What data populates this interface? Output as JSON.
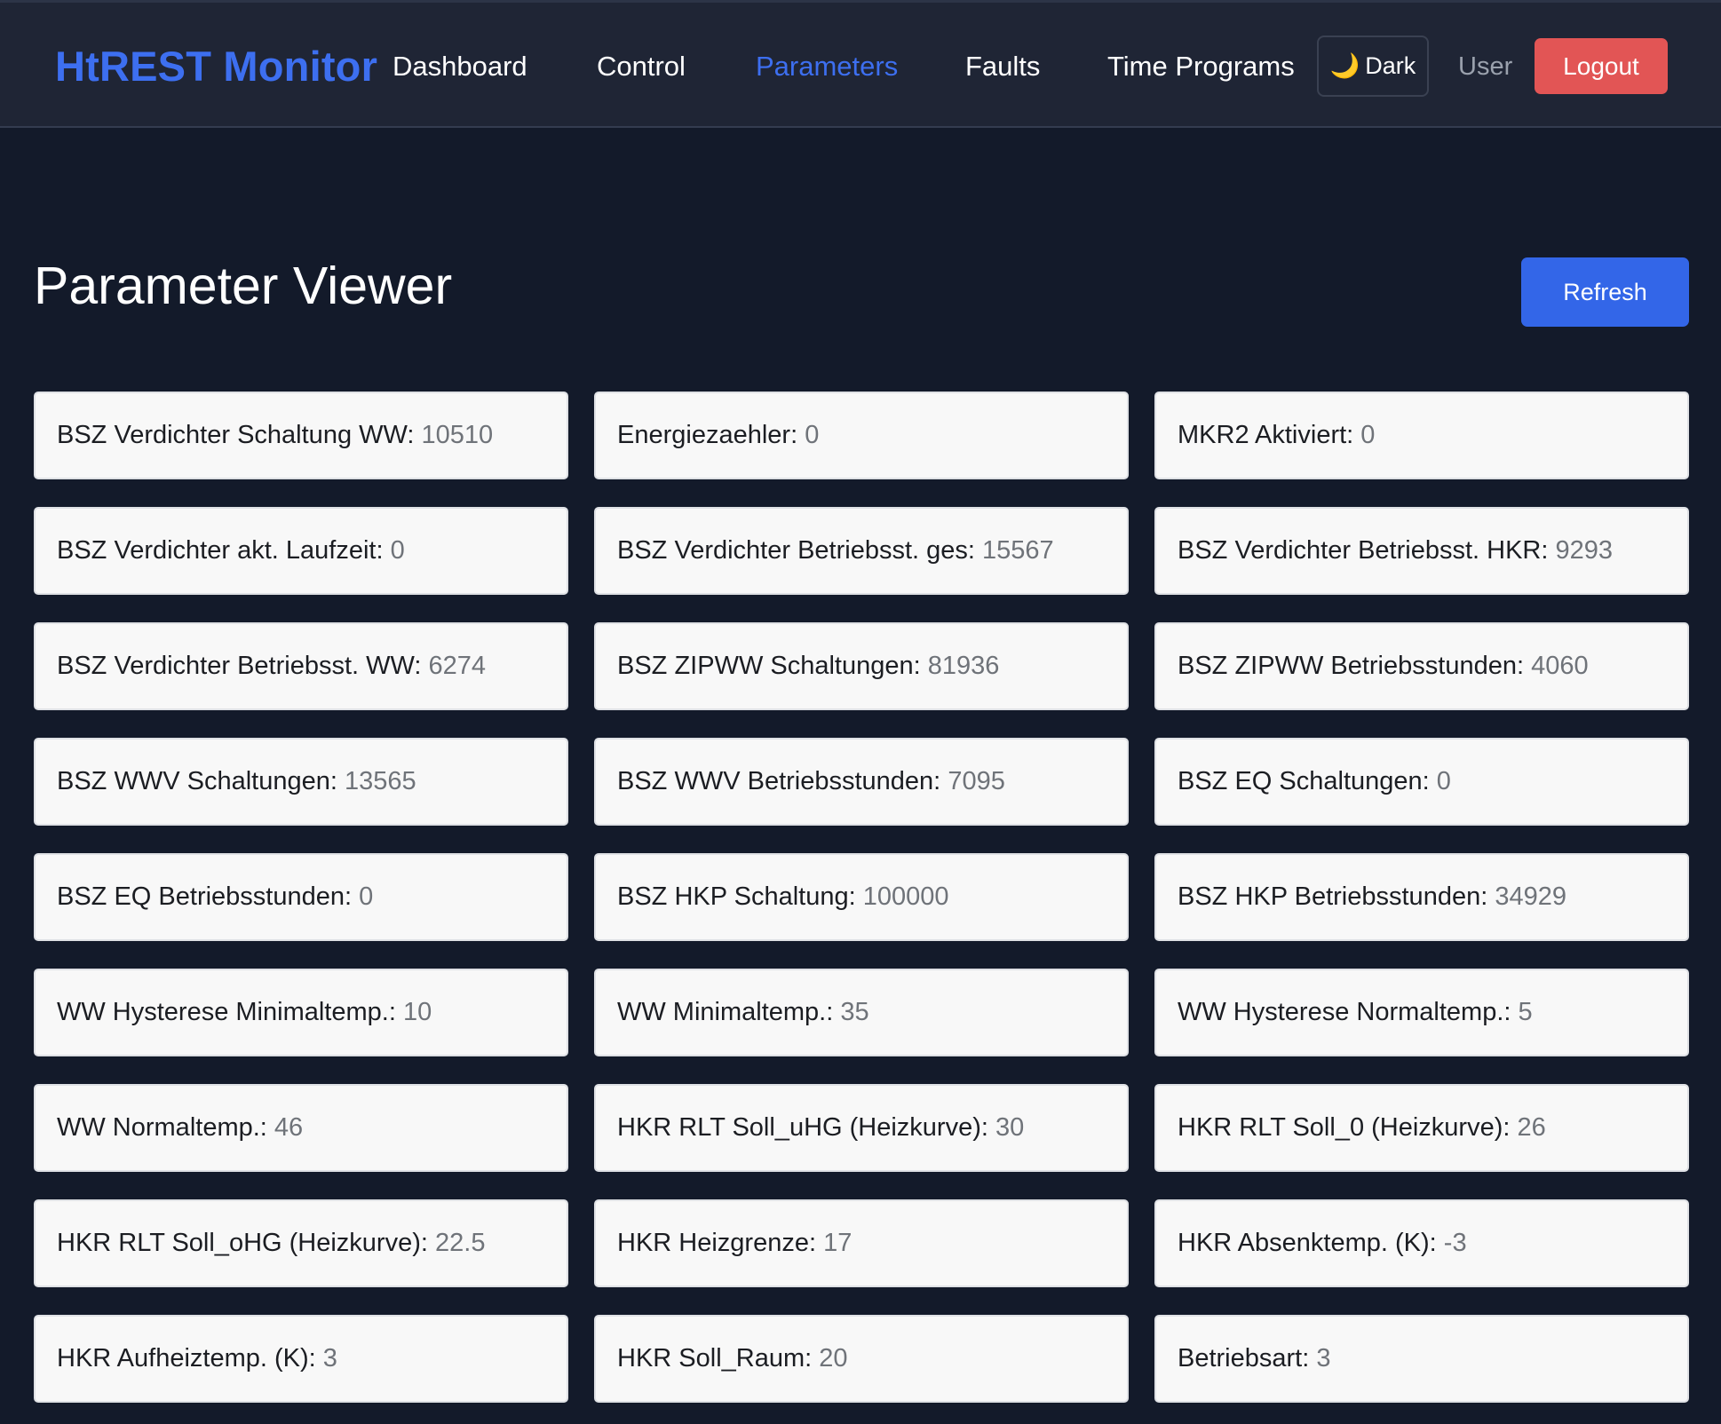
{
  "nav": {
    "brand": "HtREST Monitor",
    "links": [
      {
        "label": "Dashboard",
        "active": false
      },
      {
        "label": "Control",
        "active": false
      },
      {
        "label": "Parameters",
        "active": true
      },
      {
        "label": "Faults",
        "active": false
      },
      {
        "label": "Time Programs",
        "active": false
      }
    ],
    "theme_toggle": {
      "icon": "🌙",
      "icon_name": "moon-icon",
      "label": "Dark"
    },
    "user_label": "User",
    "logout_label": "Logout"
  },
  "page": {
    "title": "Parameter Viewer",
    "refresh_label": "Refresh"
  },
  "colors": {
    "background": "#131a2a",
    "navbar": "#1f2535",
    "accent": "#3d6ff0",
    "logout": "#e25555",
    "refresh": "#3366e8",
    "card": "#f8f8f8"
  },
  "parameters": [
    {
      "name": "BSZ Verdichter Schaltung WW:",
      "value": "10510"
    },
    {
      "name": "Energiezaehler:",
      "value": "0"
    },
    {
      "name": "MKR2 Aktiviert:",
      "value": "0"
    },
    {
      "name": "BSZ Verdichter akt. Laufzeit:",
      "value": "0"
    },
    {
      "name": "BSZ Verdichter Betriebsst. ges:",
      "value": "15567"
    },
    {
      "name": "BSZ Verdichter Betriebsst. HKR:",
      "value": "9293"
    },
    {
      "name": "BSZ Verdichter Betriebsst. WW:",
      "value": "6274"
    },
    {
      "name": "BSZ ZIPWW Schaltungen:",
      "value": "81936"
    },
    {
      "name": "BSZ ZIPWW Betriebsstunden:",
      "value": "4060"
    },
    {
      "name": "BSZ WWV Schaltungen:",
      "value": "13565"
    },
    {
      "name": "BSZ WWV Betriebsstunden:",
      "value": "7095"
    },
    {
      "name": "BSZ EQ Schaltungen:",
      "value": "0"
    },
    {
      "name": "BSZ EQ Betriebsstunden:",
      "value": "0"
    },
    {
      "name": "BSZ HKP Schaltung:",
      "value": "100000"
    },
    {
      "name": "BSZ HKP Betriebsstunden:",
      "value": "34929"
    },
    {
      "name": "WW Hysterese Minimaltemp.:",
      "value": "10"
    },
    {
      "name": "WW Minimaltemp.:",
      "value": "35"
    },
    {
      "name": "WW Hysterese Normaltemp.:",
      "value": "5"
    },
    {
      "name": "WW Normaltemp.:",
      "value": "46"
    },
    {
      "name": "HKR RLT Soll_uHG (Heizkurve):",
      "value": "30"
    },
    {
      "name": "HKR RLT Soll_0 (Heizkurve):",
      "value": "26"
    },
    {
      "name": "HKR RLT Soll_oHG (Heizkurve):",
      "value": "22.5"
    },
    {
      "name": "HKR Heizgrenze:",
      "value": "17"
    },
    {
      "name": "HKR Absenktemp. (K):",
      "value": "-3"
    },
    {
      "name": "HKR Aufheiztemp. (K):",
      "value": "3"
    },
    {
      "name": "HKR Soll_Raum:",
      "value": "20"
    },
    {
      "name": "Betriebsart:",
      "value": "3"
    }
  ]
}
